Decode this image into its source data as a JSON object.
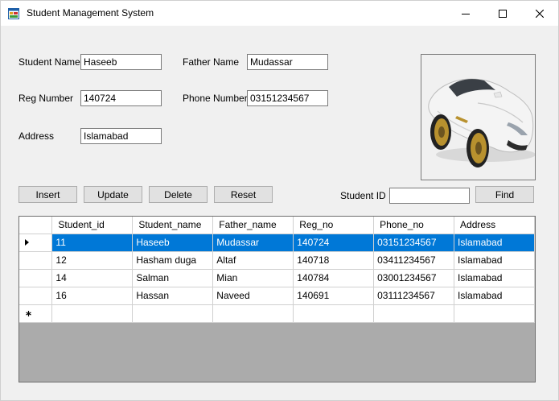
{
  "window": {
    "title": "Student Management System"
  },
  "form": {
    "student_name_label": "Student Name",
    "student_name_value": "Haseeb",
    "father_name_label": "Father Name",
    "father_name_value": "Mudassar",
    "reg_number_label": "Reg Number",
    "reg_number_value": "140724",
    "phone_number_label": "Phone Number",
    "phone_number_value": "03151234567",
    "address_label": "Address",
    "address_value": "Islamabad"
  },
  "buttons": {
    "insert": "Insert",
    "update": "Update",
    "delete": "Delete",
    "reset": "Reset",
    "find": "Find"
  },
  "search": {
    "student_id_label": "Student ID",
    "student_id_value": ""
  },
  "grid": {
    "columns": [
      "Student_id",
      "Student_name",
      "Father_name",
      "Reg_no",
      "Phone_no",
      "Address"
    ],
    "rows": [
      [
        "11",
        "Haseeb",
        "Mudassar",
        "140724",
        "03151234567",
        "Islamabad"
      ],
      [
        "12",
        "Hasham duga",
        "Altaf",
        "140718",
        "03411234567",
        "Islamabad"
      ],
      [
        "14",
        "Salman",
        "Mian",
        "140784",
        "03001234567",
        "Islamabad"
      ],
      [
        "16",
        "Hassan",
        "Naveed",
        "140691",
        "03111234567",
        "Islamabad"
      ]
    ],
    "selected_row": 0
  },
  "colors": {
    "selection": "#0078d7",
    "grid_background": "#ababab",
    "button_face": "#e1e1e1"
  },
  "icons": {
    "app": "app-form-icon",
    "minimize": "minimize-icon",
    "maximize": "maximize-icon",
    "close": "close-icon",
    "current_row": "row-pointer-icon",
    "new_row": "new-row-asterisk-icon",
    "picture": "sports-car-image"
  }
}
